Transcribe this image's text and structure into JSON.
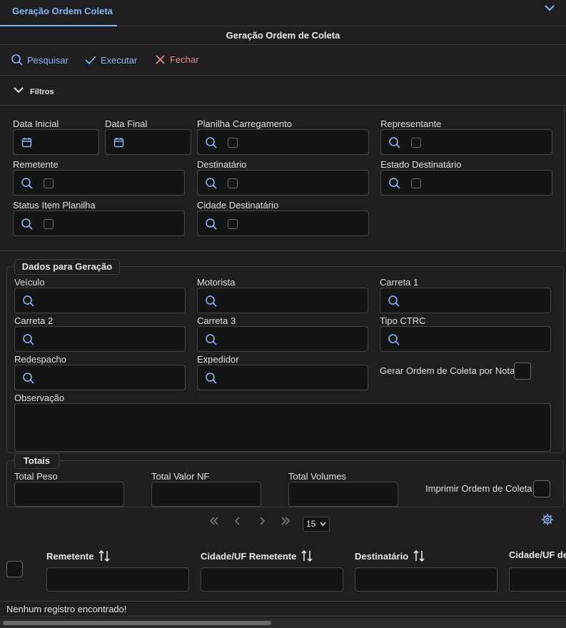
{
  "tab": {
    "label": "Geração Ordem Coleta"
  },
  "panel": {
    "title": "Geração Ordem de Coleta"
  },
  "toolbar": {
    "search": "Pesquisar",
    "execute": "Executar",
    "close": "Fechar"
  },
  "filters": {
    "title": "Filtros",
    "data_inicial": "Data Inicial",
    "data_final": "Data Final",
    "planilha": "Planilha Carregamento",
    "representante": "Representante",
    "remetente": "Remetente",
    "destinatario": "Destinatário",
    "estado_destinatario": "Estado Destinatário",
    "status_item": "Status Item Planilha",
    "cidade_destinatario": "Cidade Destinatário"
  },
  "dados": {
    "title": "Dados para Geração",
    "veiculo": "Veículo",
    "motorista": "Motorista",
    "carreta1": "Carreta 1",
    "carreta2": "Carreta 2",
    "carreta3": "Carreta 3",
    "tipo_ctrc": "Tipo CTRC",
    "redespacho": "Redespacho",
    "expedidor": "Expedidor",
    "gerar_por_nota": "Gerar Ordem de Coleta por Nota",
    "observacao": "Observação"
  },
  "totais": {
    "title": "Totais",
    "peso": "Total Peso",
    "valor_nf": "Total Valor NF",
    "volumes": "Total Volumes",
    "imprimir": "Imprimir Ordem de Coleta"
  },
  "grid": {
    "page_size": "15",
    "columns": [
      "Remetente",
      "Cidade/UF Remetente",
      "Destinatário",
      "Cidade/UF de"
    ],
    "empty_message": "Nenhum registro encontrado!"
  },
  "colors": {
    "accent": "#8ab4f8",
    "danger": "#f28b96",
    "background": "#1e1e1e",
    "field": "#141414"
  },
  "icons": [
    "chevron-down-icon",
    "search-icon",
    "check-icon",
    "close-icon",
    "calendar-icon",
    "first-page-icon",
    "prev-page-icon",
    "next-page-icon",
    "last-page-icon",
    "gear-icon",
    "sort-icon"
  ]
}
